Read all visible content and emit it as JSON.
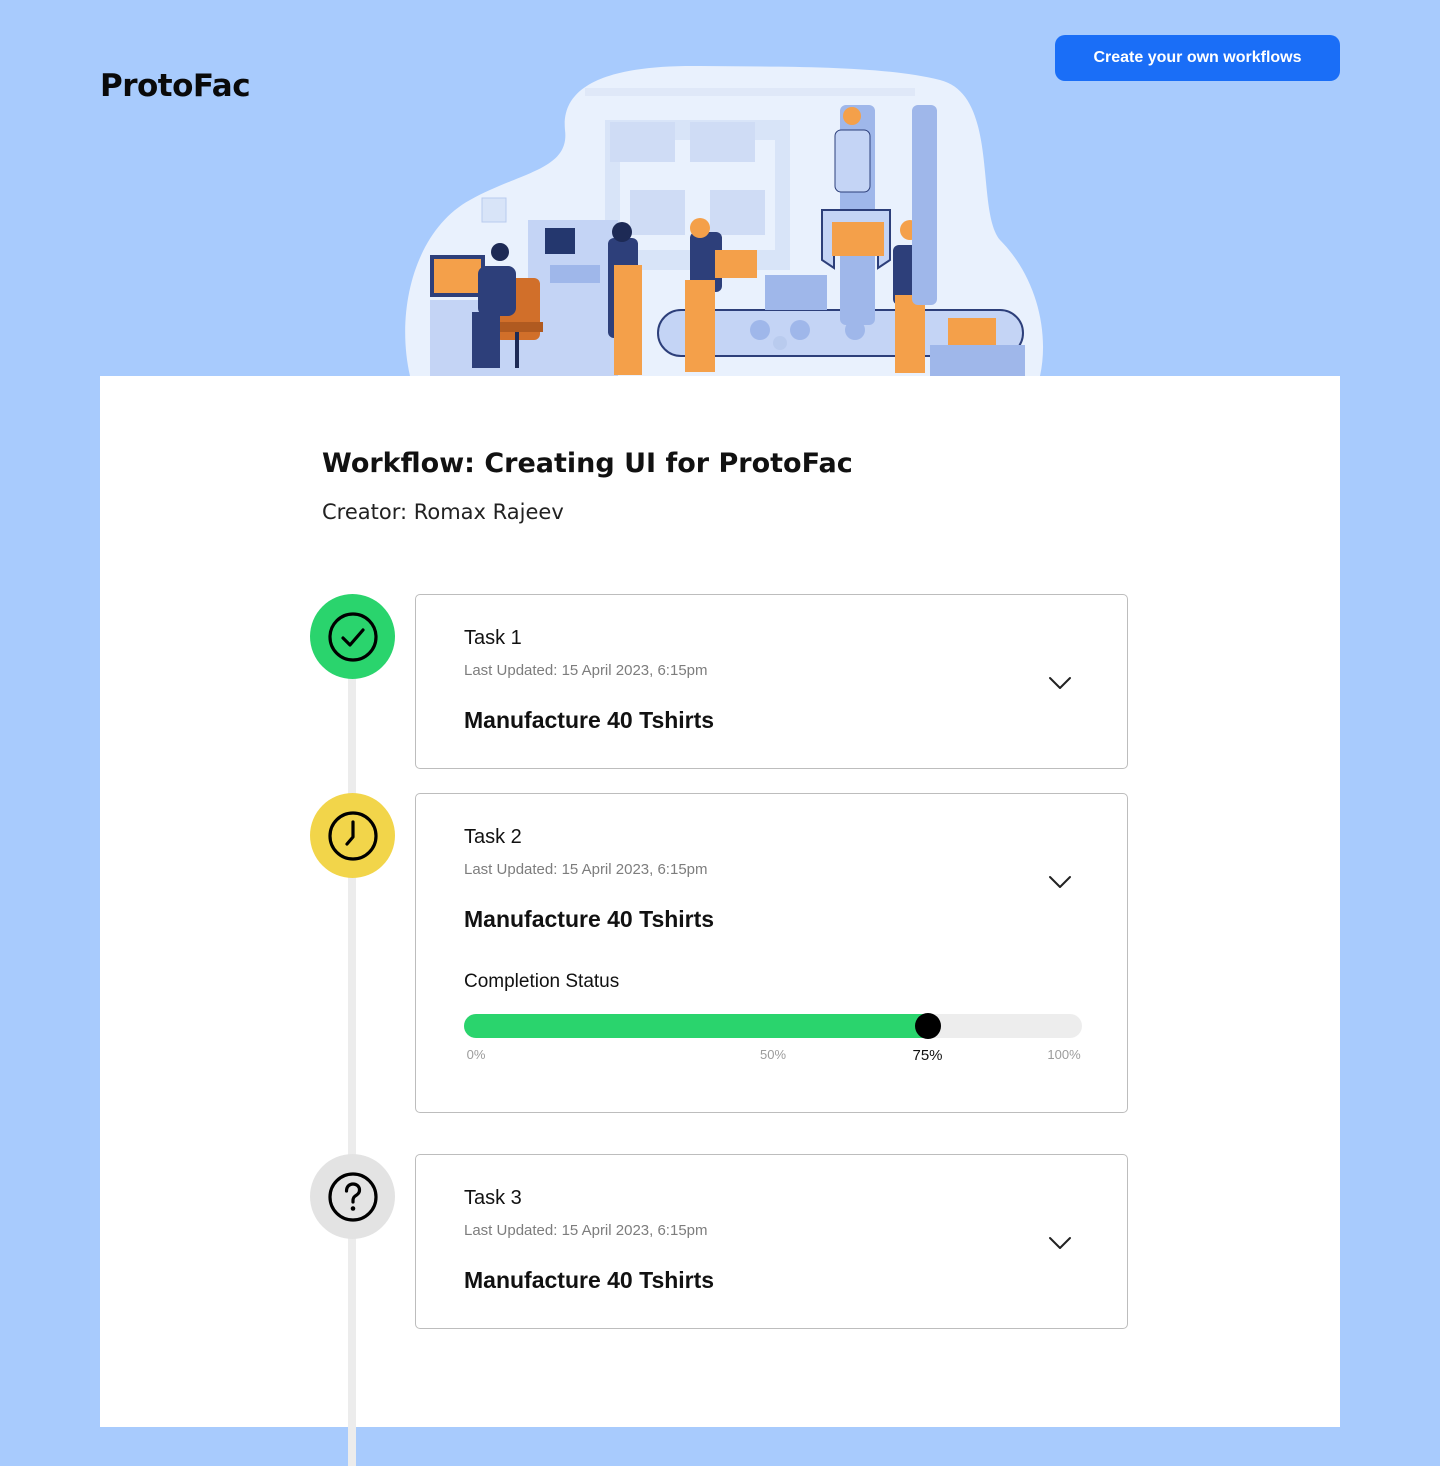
{
  "header": {
    "logo": "ProtoFac",
    "cta_label": "Create your own workflows"
  },
  "workflow": {
    "title": "Workflow: Creating UI for ProtoFac",
    "creator": "Creator: Romax Rajeev"
  },
  "tasks": [
    {
      "label": "Task 1",
      "updated": "Last Updated: 15 April 2023, 6:15pm",
      "name": "Manufacture 40 Tshirts",
      "status": "completed",
      "status_icon": "check-circle-icon",
      "status_color": "#2ad46d"
    },
    {
      "label": "Task 2",
      "updated": "Last Updated: 15 April 2023, 6:15pm",
      "name": "Manufacture 40 Tshirts",
      "status": "in-progress",
      "status_icon": "clock-icon",
      "status_color": "#f2d54a",
      "completion": {
        "label": "Completion Status",
        "value": 0.75,
        "value_label": "75%",
        "ticks": [
          "0%",
          "50%",
          "100%"
        ],
        "fill_color": "#2ad46d"
      }
    },
    {
      "label": "Task 3",
      "updated": "Last Updated: 15 April 2023, 6:15pm",
      "name": "Manufacture 40 Tshirts",
      "status": "pending",
      "status_icon": "question-circle-icon",
      "status_color": "#e3e3e3"
    }
  ],
  "colors": {
    "background": "#a8cbfd",
    "accent": "#1a6ef7"
  }
}
